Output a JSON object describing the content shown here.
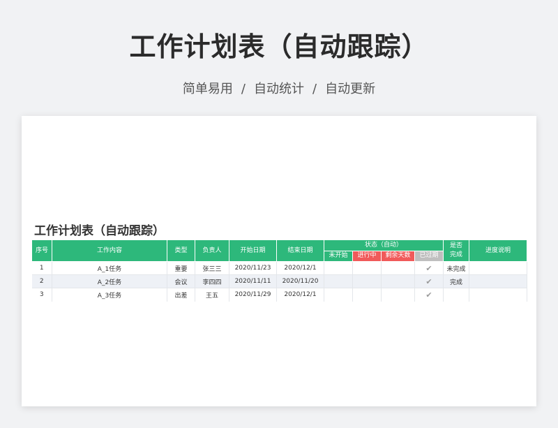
{
  "hero": {
    "title": "工作计划表（自动跟踪）",
    "subtitle_parts": [
      "简单易用",
      "/",
      "自动统计",
      "/",
      "自动更新"
    ]
  },
  "sheet": {
    "title": "工作计划表（自动跟踪）",
    "headers": {
      "index": "序号",
      "task": "工作内容",
      "type": "类型",
      "owner": "负责人",
      "start": "开始日期",
      "end": "结束日期",
      "status_group": "状态（自动）",
      "status_not_started": "未开始",
      "status_in_progress": "进行中",
      "status_remaining": "剩余天数",
      "status_overdue": "已过期",
      "done_line1": "是否",
      "done_line2": "完成",
      "progress_note": "进度说明"
    },
    "rows": [
      {
        "index": "1",
        "task": "A_1任务",
        "type": "重要",
        "owner": "张三三",
        "start": "2020/11/23",
        "end": "2020/12/1",
        "overdue": "✔",
        "done": "未完成"
      },
      {
        "index": "2",
        "task": "A_2任务",
        "type": "会议",
        "owner": "李四四",
        "start": "2020/11/11",
        "end": "2020/11/20",
        "overdue": "✔",
        "done": "完成"
      },
      {
        "index": "3",
        "task": "A_3任务",
        "type": "出差",
        "owner": "王五",
        "start": "2020/11/29",
        "end": "2020/12/1",
        "overdue": "✔",
        "done": ""
      }
    ]
  },
  "colors": {
    "header_green": "#2db87b",
    "status_red": "#f05a5a",
    "status_gray": "#bfbfbf"
  }
}
